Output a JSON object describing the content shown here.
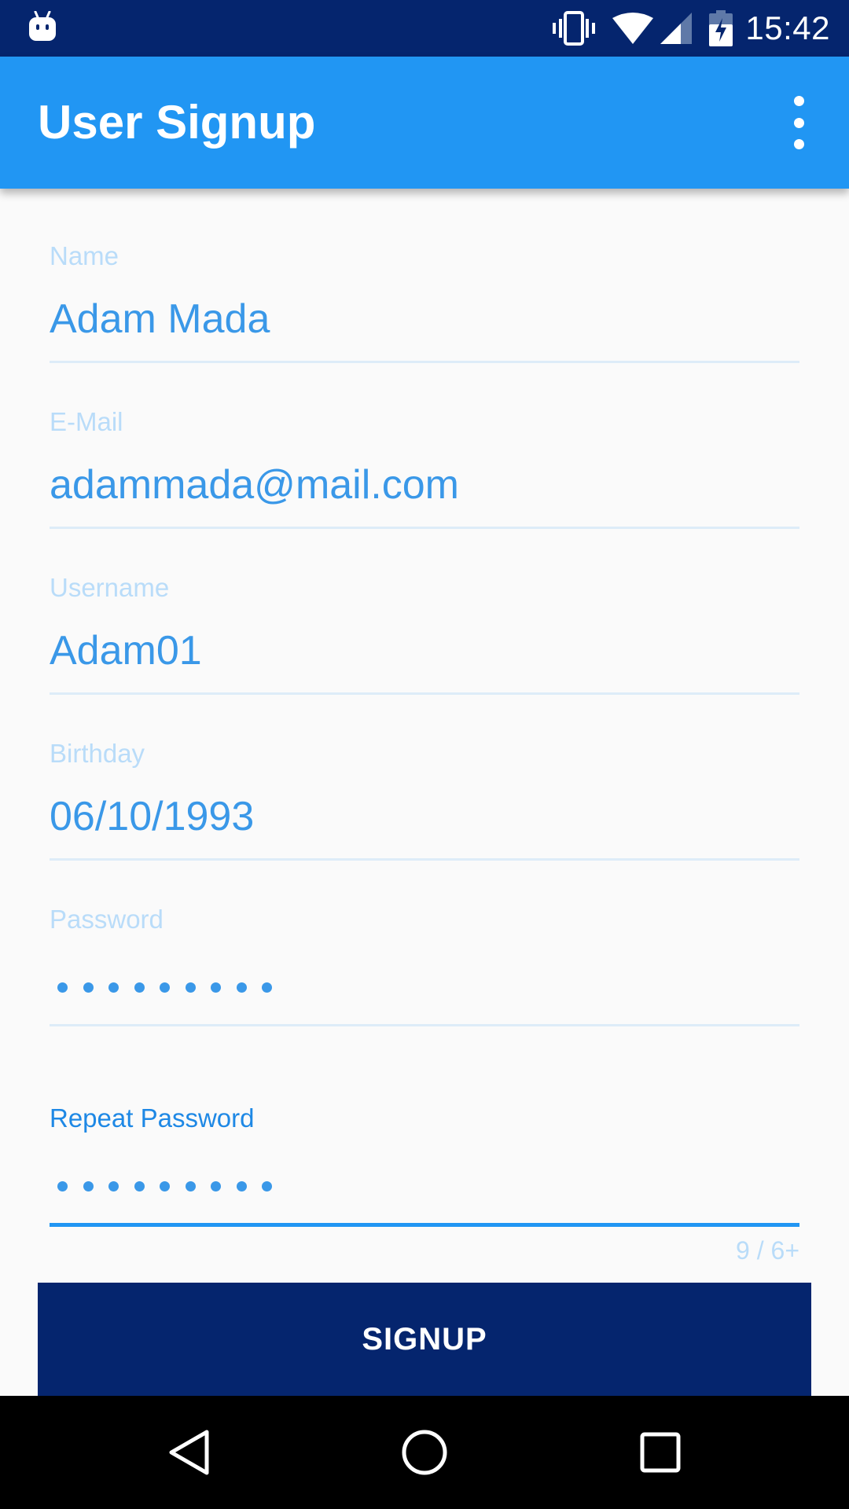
{
  "status_bar": {
    "time": "15:42",
    "icons": [
      "android-notification-icon",
      "vibrate-icon",
      "wifi-icon",
      "cell-signal-icon",
      "battery-charging-icon"
    ]
  },
  "app_bar": {
    "title": "User Signup",
    "menu_icon": "overflow-menu-icon"
  },
  "form": {
    "name": {
      "label": "Name",
      "value": "Adam Mada"
    },
    "email": {
      "label": "E-Mail",
      "value": "adammada@mail.com"
    },
    "username": {
      "label": "Username",
      "value": "Adam01"
    },
    "birthday": {
      "label": "Birthday",
      "value": "06/10/1993"
    },
    "password": {
      "label": "Password",
      "masked_length": 9
    },
    "repeat_password": {
      "label": "Repeat Password",
      "masked_length": 9,
      "counter": "9 / 6+"
    }
  },
  "signup_button": {
    "label": "SIGNUP"
  },
  "nav_bar": {
    "icons": [
      "back-icon",
      "home-icon",
      "recents-icon"
    ]
  },
  "colors": {
    "status_bar": "#05256e",
    "app_bar": "#2196f3",
    "accent": "#2196f3",
    "text_value": "#3a98e8",
    "label_inactive": "#b9dcf9",
    "button": "#05256e",
    "background": "#fafafa"
  }
}
